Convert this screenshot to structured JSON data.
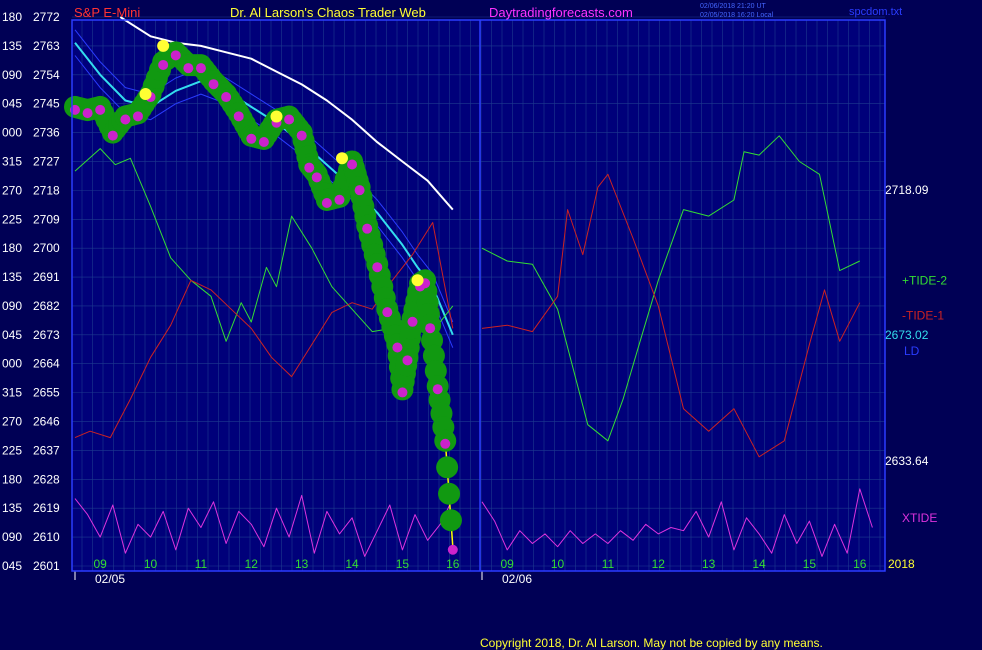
{
  "header": {
    "symbol": "S&P E-Mini",
    "title": "Dr. Al Larson's Chaos Trader Web",
    "site": "Daytradingforecasts.com",
    "stamp_line1": "02/06/2018 21:20 UT",
    "stamp_line2": "02/05/2018 16:20 Local",
    "file": "spcdom.txt"
  },
  "footer": {
    "copyright": "Copyright 2018, Dr. Al Larson. May not be copied by any means."
  },
  "colors": {
    "background": "#000055",
    "plot_background": "#00007a",
    "grid": "#1d3a8f",
    "axis": "#2a3cff",
    "price": "#ffff00",
    "tide_plus": "#33dd33",
    "tide_minus": "#cc2222",
    "ld": "#33ddee",
    "xtide": "#dd33dd",
    "avg": "#ffffff",
    "dot_big": "#119911",
    "dot_magenta": "#cc22cc",
    "dot_yellow": "#ffff33"
  },
  "chart_data": {
    "type": "line",
    "title": "S&P E-Mini",
    "xlabel": "",
    "ylabel": "",
    "ylim": [
      2601,
      2772
    ],
    "y_ticks": [
      {
        "angle": "180",
        "price": "2772"
      },
      {
        "angle": "135",
        "price": "2763"
      },
      {
        "angle": "090",
        "price": "2754"
      },
      {
        "angle": "045",
        "price": "2745"
      },
      {
        "angle": "000",
        "price": "2736"
      },
      {
        "angle": "315",
        "price": "2727"
      },
      {
        "angle": "270",
        "price": "2718"
      },
      {
        "angle": "225",
        "price": "2709"
      },
      {
        "angle": "180",
        "price": "2700"
      },
      {
        "angle": "135",
        "price": "2691"
      },
      {
        "angle": "090",
        "price": "2682"
      },
      {
        "angle": "045",
        "price": "2673"
      },
      {
        "angle": "000",
        "price": "2664"
      },
      {
        "angle": "315",
        "price": "2655"
      },
      {
        "angle": "270",
        "price": "2646"
      },
      {
        "angle": "225",
        "price": "2637"
      },
      {
        "angle": "180",
        "price": "2628"
      },
      {
        "angle": "135",
        "price": "2619"
      },
      {
        "angle": "090",
        "price": "2610"
      },
      {
        "angle": "045",
        "price": "2601"
      }
    ],
    "x_hours": [
      "09",
      "10",
      "11",
      "12",
      "13",
      "14",
      "15",
      "16",
      "09",
      "10",
      "11",
      "12",
      "13",
      "14",
      "15",
      "16"
    ],
    "x_hours_range": [
      8.5,
      16.5
    ],
    "dates": [
      "02/05",
      "02/06"
    ],
    "year_label": "2018",
    "grid": true,
    "right_labels": [
      {
        "text": "2718.09",
        "value": 2718.09,
        "color": "#ffffff"
      },
      {
        "text": "+TIDE-2",
        "value": 2690,
        "color": "#33dd33"
      },
      {
        "text": "-TIDE-1",
        "value": 2679,
        "color": "#cc2222"
      },
      {
        "text": "2673.02",
        "value": 2673.02,
        "color": "#33ddee"
      },
      {
        "text": "LD",
        "value": 2668,
        "color": "#2a3cff"
      },
      {
        "text": "2633.64",
        "value": 2633.64,
        "color": "#ffffff"
      },
      {
        "text": "XTIDE",
        "value": 2616,
        "color": "#dd33dd"
      }
    ],
    "series": [
      {
        "name": "LD",
        "day": 1,
        "x": [
          8.5,
          9.0,
          9.5,
          10.0,
          10.5,
          11.0,
          11.5,
          12.0,
          12.5,
          13.0,
          13.5,
          14.0,
          14.5,
          15.0,
          15.3,
          15.6,
          16.0
        ],
        "values": [
          2764,
          2754,
          2746,
          2744,
          2749,
          2752,
          2749,
          2744,
          2739,
          2733,
          2726,
          2719,
          2711,
          2701,
          2694,
          2688,
          2673
        ]
      },
      {
        "name": "+TIDE-2",
        "day": 1,
        "x": [
          8.5,
          9.0,
          9.3,
          9.6,
          10.0,
          10.4,
          10.8,
          11.2,
          11.5,
          11.8,
          12.0,
          12.3,
          12.5,
          12.8,
          13.2,
          13.6,
          14.0,
          14.4,
          14.8,
          15.2,
          15.6,
          16.0
        ],
        "values": [
          2724,
          2731,
          2726,
          2728,
          2713,
          2697,
          2690,
          2685,
          2671,
          2683,
          2677,
          2694,
          2688,
          2710,
          2700,
          2688,
          2681,
          2674,
          2675,
          2680,
          2674,
          2682
        ],
        "day2_x": [
          8.5,
          9.0,
          9.5,
          10.0,
          10.3,
          10.6,
          11.0,
          11.3,
          11.6,
          12.0,
          12.5,
          13.0,
          13.5,
          13.7,
          14.0,
          14.4,
          14.8,
          15.2,
          15.6,
          16.0
        ],
        "day2_values": [
          2700,
          2696,
          2695,
          2681,
          2663,
          2645,
          2640,
          2653,
          2669,
          2690,
          2712,
          2710,
          2715,
          2730,
          2729,
          2735,
          2727,
          2723,
          2693,
          2696
        ]
      },
      {
        "name": "-TIDE-1",
        "day": 1,
        "x": [
          8.5,
          8.8,
          9.2,
          9.6,
          10.0,
          10.4,
          10.8,
          11.2,
          11.6,
          12.0,
          12.4,
          12.8,
          13.2,
          13.6,
          14.0,
          14.4,
          14.8,
          15.2,
          15.6,
          16.0
        ],
        "values": [
          2641,
          2643,
          2641,
          2653,
          2666,
          2676,
          2690,
          2687,
          2681,
          2675,
          2666,
          2660,
          2670,
          2680,
          2683,
          2681,
          2690,
          2698,
          2708,
          2675
        ],
        "day2_x": [
          8.5,
          9.0,
          9.5,
          10.0,
          10.2,
          10.5,
          10.8,
          11.0,
          11.5,
          12.0,
          12.5,
          13.0,
          13.5,
          14.0,
          14.5,
          15.0,
          15.3,
          15.6,
          16.0
        ],
        "day2_values": [
          2675,
          2676,
          2674,
          2685,
          2712,
          2698,
          2719,
          2723,
          2703,
          2682,
          2650,
          2643,
          2650,
          2635,
          2640,
          2670,
          2687,
          2671,
          2683
        ]
      },
      {
        "name": "Average",
        "day": 1,
        "x": [
          9.4,
          10.0,
          10.5,
          11.0,
          11.5,
          12.0,
          12.5,
          13.0,
          13.5,
          14.0,
          14.5,
          15.0,
          15.5,
          16.0
        ],
        "values": [
          2772,
          2766,
          2764,
          2763,
          2761,
          2759,
          2755,
          2751,
          2746,
          2740,
          2733,
          2727,
          2721,
          2712
        ]
      },
      {
        "name": "XTIDE",
        "day": 1,
        "x": [
          8.5,
          8.75,
          9.0,
          9.25,
          9.5,
          9.75,
          10.0,
          10.25,
          10.5,
          10.75,
          11.0,
          11.25,
          11.5,
          11.75,
          12.0,
          12.25,
          12.5,
          12.75,
          13.0,
          13.25,
          13.5,
          13.75,
          14.0,
          14.25,
          14.5,
          14.75,
          15.0,
          15.25,
          15.5,
          15.75,
          16.0
        ],
        "values": [
          2622,
          2617,
          2610,
          2620,
          2605,
          2614,
          2610,
          2618,
          2606,
          2619,
          2613,
          2621,
          2608,
          2618,
          2614,
          2607,
          2619,
          2610,
          2623,
          2605,
          2618,
          2611,
          2616,
          2604,
          2612,
          2620,
          2606,
          2617,
          2609,
          2614,
          2622
        ],
        "day2_x": [
          8.5,
          8.75,
          9.0,
          9.25,
          9.5,
          9.75,
          10.0,
          10.25,
          10.5,
          10.75,
          11.0,
          11.25,
          11.5,
          11.75,
          12.0,
          12.25,
          12.5,
          12.75,
          13.0,
          13.25,
          13.5,
          13.75,
          14.0,
          14.25,
          14.5,
          14.75,
          15.0,
          15.25,
          15.5,
          15.75,
          16.0,
          16.25
        ],
        "day2_values": [
          2621,
          2615,
          2606,
          2612,
          2608,
          2611,
          2607,
          2612,
          2608,
          2611,
          2608,
          2612,
          2609,
          2614,
          2611,
          2613,
          2612,
          2618,
          2610,
          2621,
          2606,
          2616,
          2611,
          2605,
          2617,
          2608,
          2615,
          2604,
          2614,
          2605,
          2625,
          2613
        ]
      },
      {
        "name": "S&P E-Mini",
        "day": 1,
        "x": [
          8.5,
          8.75,
          9.0,
          9.25,
          9.5,
          9.75,
          10.0,
          10.25,
          10.5,
          10.75,
          11.0,
          11.25,
          11.5,
          11.75,
          12.0,
          12.25,
          12.5,
          12.75,
          13.0,
          13.15,
          13.3,
          13.5,
          13.75,
          14.0,
          14.15,
          14.3,
          14.5,
          14.7,
          14.9,
          15.0,
          15.1,
          15.2,
          15.35,
          15.45,
          15.55,
          15.7,
          15.85,
          16.0
        ],
        "values": [
          2744,
          2743,
          2744,
          2736,
          2741,
          2742,
          2748,
          2758,
          2761,
          2757,
          2757,
          2752,
          2748,
          2742,
          2735,
          2734,
          2740,
          2741,
          2736,
          2726,
          2723,
          2715,
          2716,
          2727,
          2719,
          2707,
          2695,
          2681,
          2670,
          2656,
          2666,
          2678,
          2689,
          2690,
          2676,
          2657,
          2640,
          2607
        ]
      }
    ]
  }
}
